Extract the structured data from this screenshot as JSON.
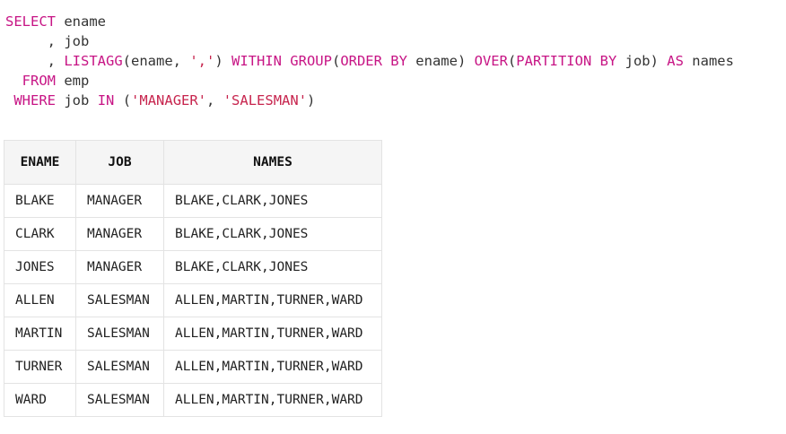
{
  "sql": {
    "line1": {
      "kw1": "SELECT",
      "rest": " ename"
    },
    "line2": {
      "rest": "     , job"
    },
    "line3": {
      "lead": "     , ",
      "kw_listagg": "LISTAGG",
      "p1": "(ename, ",
      "str": "','",
      "p2": ") ",
      "kw_within": "WITHIN GROUP",
      "p3": "(",
      "kw_orderby": "ORDER BY",
      "p4": " ename) ",
      "kw_over": "OVER",
      "p5": "(",
      "kw_partition": "PARTITION BY",
      "p6": " job) ",
      "kw_as": "AS",
      "p7": " names"
    },
    "line4": {
      "lead": "  ",
      "kw": "FROM",
      "rest": " emp"
    },
    "line5": {
      "lead": " ",
      "kw_where": "WHERE",
      "p1": " job ",
      "kw_in": "IN",
      "p2": " (",
      "str1": "'MANAGER'",
      "p3": ", ",
      "str2": "'SALESMAN'",
      "p4": ")"
    }
  },
  "result_table": {
    "headers": [
      "ENAME",
      "JOB",
      "NAMES"
    ],
    "rows": [
      [
        "BLAKE",
        "MANAGER",
        "BLAKE,CLARK,JONES"
      ],
      [
        "CLARK",
        "MANAGER",
        "BLAKE,CLARK,JONES"
      ],
      [
        "JONES",
        "MANAGER",
        "BLAKE,CLARK,JONES"
      ],
      [
        "ALLEN",
        "SALESMAN",
        "ALLEN,MARTIN,TURNER,WARD"
      ],
      [
        "MARTIN",
        "SALESMAN",
        "ALLEN,MARTIN,TURNER,WARD"
      ],
      [
        "TURNER",
        "SALESMAN",
        "ALLEN,MARTIN,TURNER,WARD"
      ],
      [
        "WARD",
        "SALESMAN",
        "ALLEN,MARTIN,TURNER,WARD"
      ]
    ]
  },
  "colors": {
    "keyword": "#c71585",
    "string": "#c7254e",
    "text": "#333333",
    "table_border": "#e3e3e3",
    "header_bg": "#f5f5f5"
  }
}
